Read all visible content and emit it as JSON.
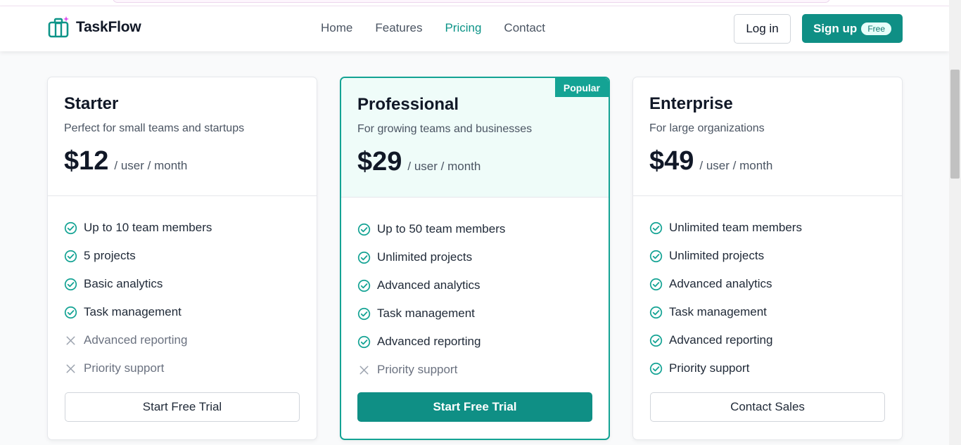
{
  "brand": {
    "name": "TaskFlow",
    "color": "#0d9488",
    "logo_icon": "toolbox-sparkle-icon"
  },
  "nav": {
    "items": [
      {
        "label": "Home",
        "active": false
      },
      {
        "label": "Features",
        "active": false
      },
      {
        "label": "Pricing",
        "active": true
      },
      {
        "label": "Contact",
        "active": false
      }
    ]
  },
  "auth": {
    "login_label": "Log in",
    "signup_label": "Sign up",
    "signup_badge": "Free"
  },
  "plans": [
    {
      "name": "Starter",
      "description": "Perfect for small teams and startups",
      "price": "$12",
      "period": "/ user / month",
      "features": [
        {
          "label": "Up to 10 team members",
          "included": true
        },
        {
          "label": "5 projects",
          "included": true
        },
        {
          "label": "Basic analytics",
          "included": true
        },
        {
          "label": "Task management",
          "included": true
        },
        {
          "label": "Advanced reporting",
          "included": false
        },
        {
          "label": "Priority support",
          "included": false
        }
      ],
      "cta": "Start Free Trial"
    },
    {
      "name": "Professional",
      "badge": "Popular",
      "description": "For growing teams and businesses",
      "price": "$29",
      "period": "/ user / month",
      "features": [
        {
          "label": "Up to 50 team members",
          "included": true
        },
        {
          "label": "Unlimited projects",
          "included": true
        },
        {
          "label": "Advanced analytics",
          "included": true
        },
        {
          "label": "Task management",
          "included": true
        },
        {
          "label": "Advanced reporting",
          "included": true
        },
        {
          "label": "Priority support",
          "included": false
        }
      ],
      "cta": "Start Free Trial"
    },
    {
      "name": "Enterprise",
      "description": "For large organizations",
      "price": "$49",
      "period": "/ user / month",
      "features": [
        {
          "label": "Unlimited team members",
          "included": true
        },
        {
          "label": "Unlimited projects",
          "included": true
        },
        {
          "label": "Advanced analytics",
          "included": true
        },
        {
          "label": "Task management",
          "included": true
        },
        {
          "label": "Advanced reporting",
          "included": true
        },
        {
          "label": "Priority support",
          "included": true
        }
      ],
      "cta": "Contact Sales"
    }
  ],
  "icons": {
    "included": "check-circle-icon",
    "excluded": "x-icon"
  },
  "colors": {
    "accent": "#0f8f85",
    "accent_light": "#effcf9",
    "check": "#14a394",
    "cross": "#9ca3af"
  }
}
